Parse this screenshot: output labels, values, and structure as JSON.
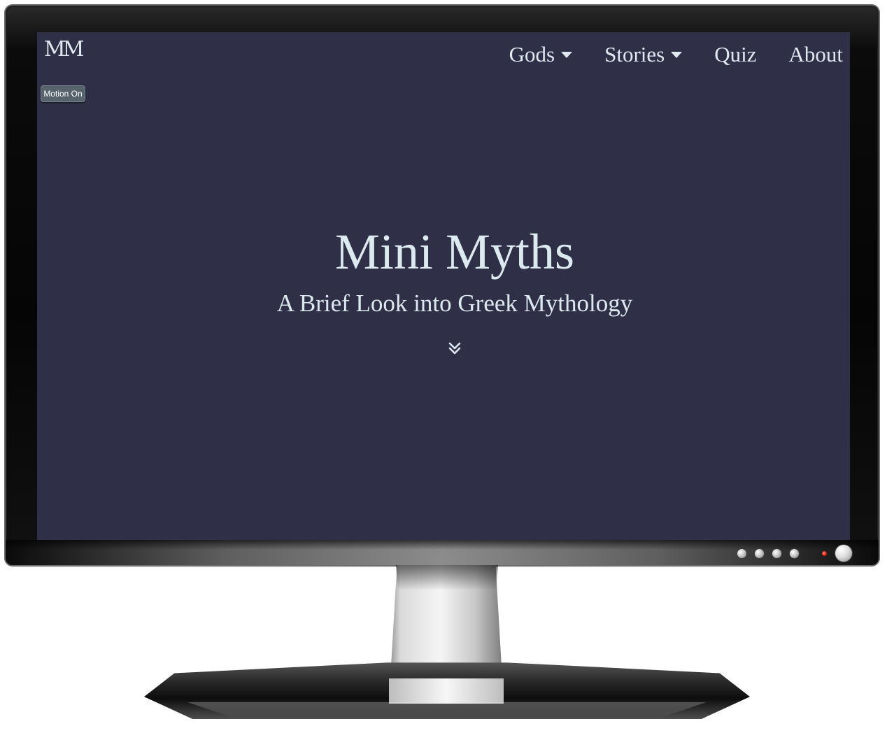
{
  "site": {
    "logo_text": "MM",
    "nav": {
      "items": [
        {
          "label": "Gods",
          "has_dropdown": true
        },
        {
          "label": "Stories",
          "has_dropdown": true
        },
        {
          "label": "Quiz",
          "has_dropdown": false
        },
        {
          "label": "About",
          "has_dropdown": false
        }
      ]
    },
    "motion_toggle_label": "Motion On",
    "hero": {
      "title": "Mini Myths",
      "subtitle": "A Brief Look into Greek Mythology",
      "scroll_icon": "double-chevron-down-icon"
    }
  },
  "colors": {
    "screen_background": "#2f3048",
    "text": "#dce9ee",
    "motion_button": "#56626c"
  }
}
